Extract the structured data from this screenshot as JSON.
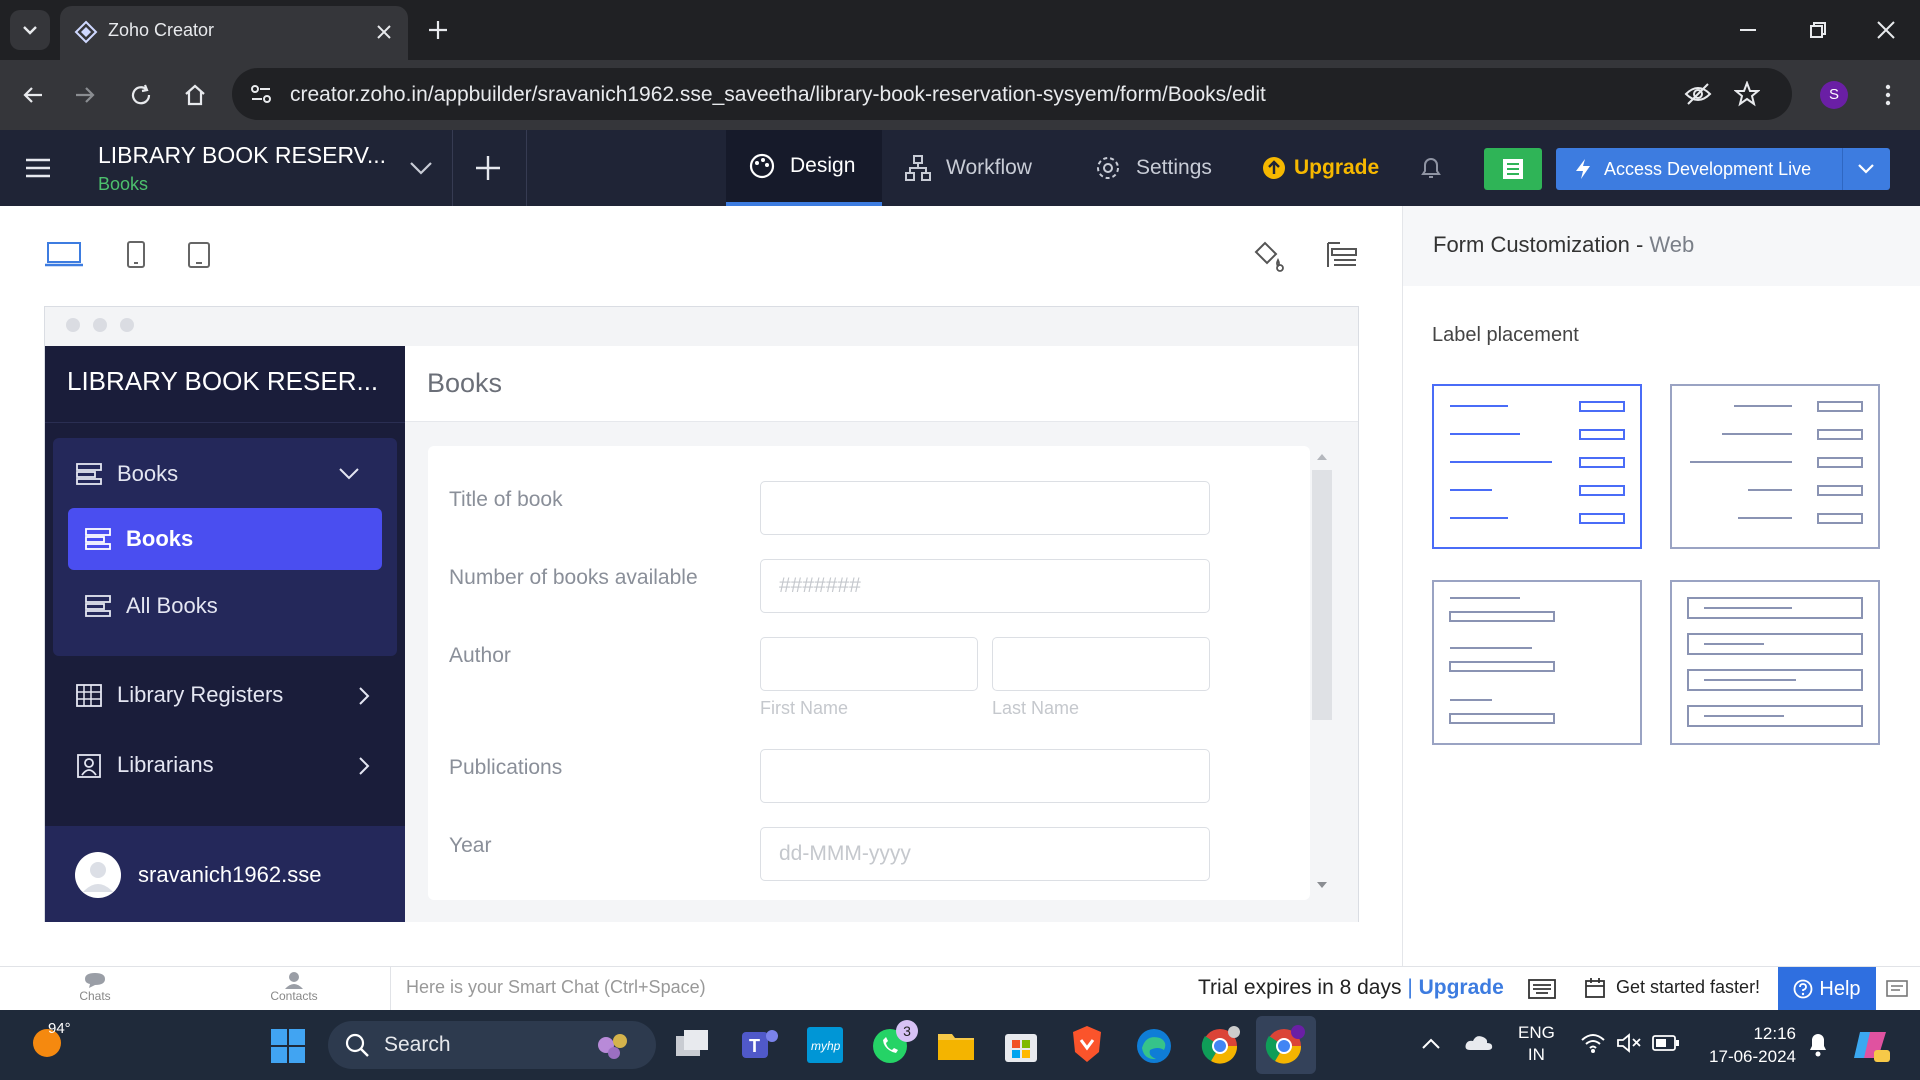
{
  "browser": {
    "tab_title": "Zoho Creator",
    "url": "creator.zoho.in/appbuilder/sravanich1962.sse_saveetha/library-book-reservation-sysyem/form/Books/edit",
    "profile_initial": "S"
  },
  "app": {
    "title": "LIBRARY BOOK RESERV...",
    "subtitle": "Books",
    "nav": {
      "design": "Design",
      "workflow": "Workflow",
      "settings": "Settings",
      "upgrade": "Upgrade",
      "access_live": "Access Development Live"
    }
  },
  "preview": {
    "app_name": "LIBRARY BOOK RESER...",
    "form_title": "Books",
    "sidebar": {
      "group_label": "Books",
      "active_item": "Books",
      "item_all_books": "All Books",
      "item_registers": "Library Registers",
      "item_librarians": "Librarians",
      "username": "sravanich1962.sse"
    },
    "fields": {
      "title_label": "Title of book",
      "number_label": "Number of books available",
      "number_placeholder": "#######",
      "author_label": "Author",
      "first_name": "First Name",
      "last_name": "Last Name",
      "publications_label": "Publications",
      "year_label": "Year",
      "year_placeholder": "dd-MMM-yyyy"
    }
  },
  "panel": {
    "title": "Form Customization",
    "title_suffix": "Web",
    "label_placement": "Label placement"
  },
  "chatbar": {
    "chats": "Chats",
    "contacts": "Contacts",
    "smart_chat_placeholder": "Here is your Smart Chat (Ctrl+Space)",
    "trial": "Trial expires in 8 days",
    "upgrade": "Upgrade",
    "get_started": "Get started faster!",
    "help": "Help"
  },
  "taskbar": {
    "temperature": "94°",
    "search": "Search",
    "whatsapp_badge": "3",
    "lang_top": "ENG",
    "lang_bottom": "IN",
    "time": "12:16",
    "date": "17-06-2024"
  },
  "colors": {
    "accent": "#4a4ef0",
    "header_bg": "#1f2436",
    "sidebar_bg": "#1a1d3a",
    "upgrade": "#f6b800",
    "live_button": "#3d7ce0",
    "green_button": "#2fb457"
  }
}
